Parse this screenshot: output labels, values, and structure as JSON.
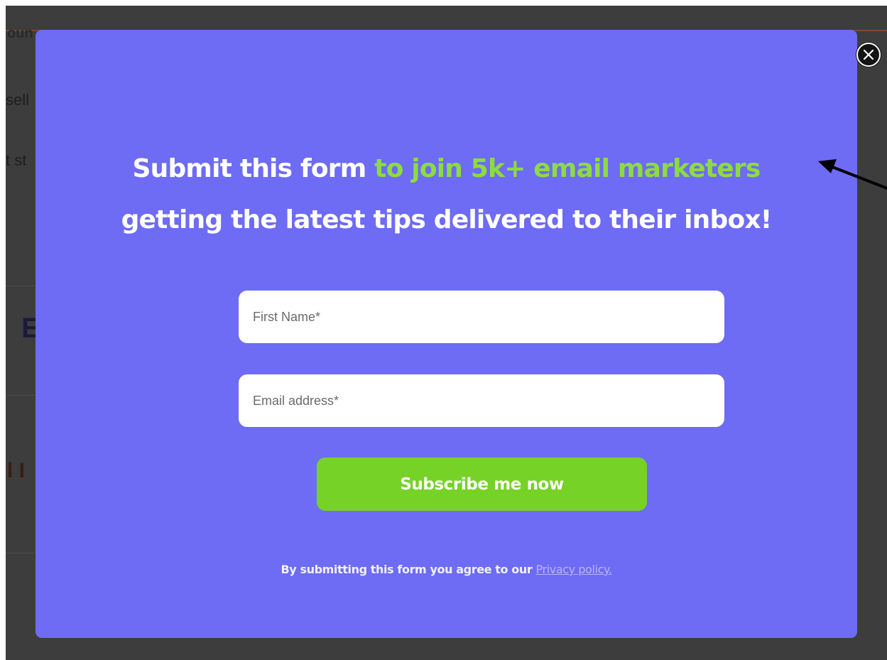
{
  "background": {
    "fragments": [
      "oun",
      "sell",
      "t st",
      "E",
      "l I"
    ]
  },
  "popup": {
    "headline": {
      "part1": "Submit this form ",
      "highlight": "to join 5k+ email marketers",
      "line2": "getting the latest tips delivered to their inbox!"
    },
    "first_name": {
      "placeholder": "First Name*",
      "value": ""
    },
    "email": {
      "placeholder": "Email address*",
      "value": ""
    },
    "submit_label": "Subscribe me now",
    "legal": {
      "text": "By submitting this form you agree to our ",
      "link": "Privacy policy."
    },
    "close_icon": "close-icon"
  },
  "colors": {
    "overlay": "#3d3d3d",
    "modal": "#6e6bf5",
    "accent_green": "#8ddc3f",
    "button_green": "#76d226",
    "link": "#b9b6ff"
  }
}
